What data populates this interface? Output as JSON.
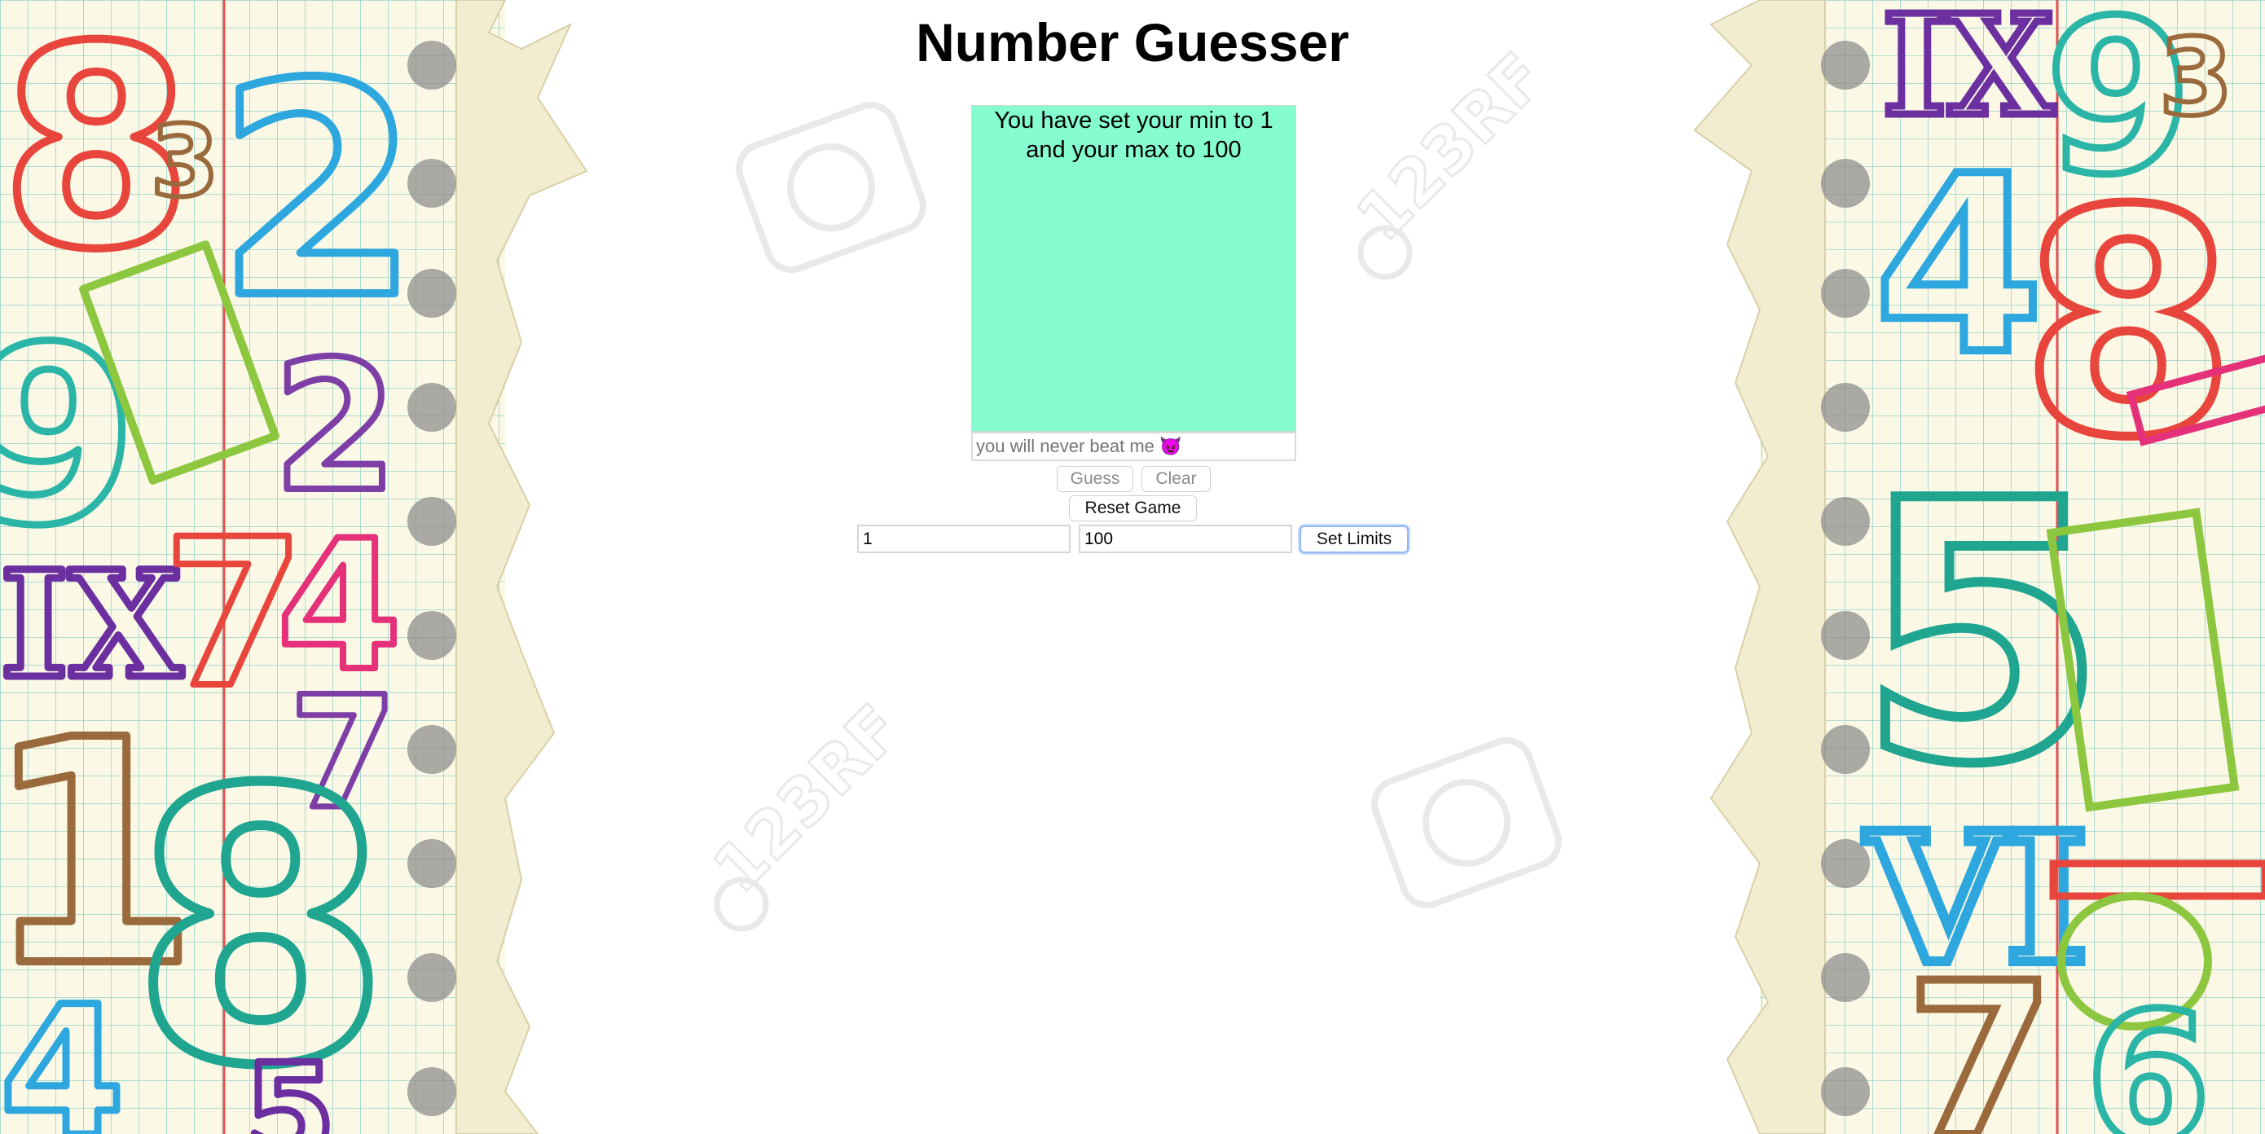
{
  "header": {
    "title": "Number Guesser"
  },
  "output": {
    "line1": "You have set your min to 1",
    "line2": "and your max to 100",
    "color": "#86fdd0"
  },
  "guess_input": {
    "value": "",
    "placeholder": "you will never beat me 😈"
  },
  "buttons": {
    "guess_label": "Guess",
    "clear_label": "Clear",
    "reset_label": "Reset Game",
    "set_limits_label": "Set Limits"
  },
  "limits": {
    "min_value": "1",
    "max_value": "100"
  },
  "watermark": {
    "text": "123RF"
  }
}
